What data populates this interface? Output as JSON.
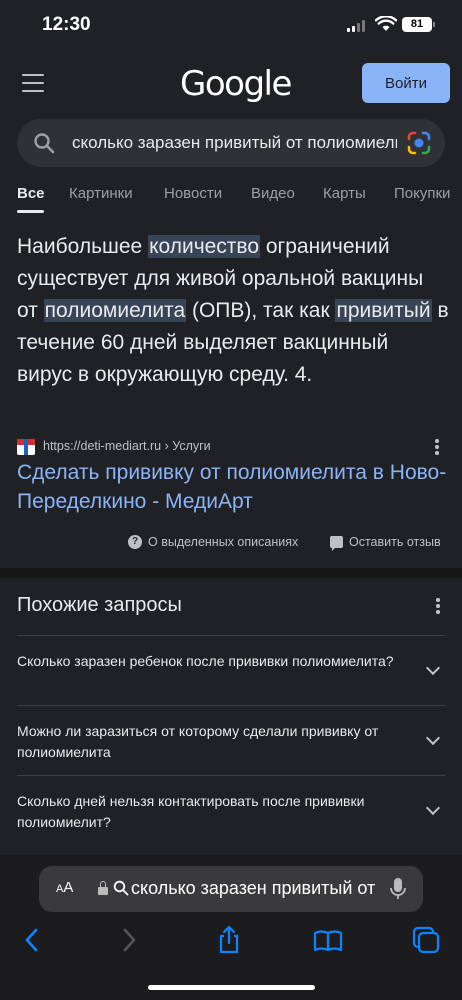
{
  "status_bar": {
    "time": "12:30",
    "battery": "81"
  },
  "header": {
    "logo": "Google",
    "login_label": "Войти"
  },
  "search": {
    "query": "сколько заразен привитый от полиомиелита"
  },
  "tabs": [
    "Все",
    "Картинки",
    "Новости",
    "Видео",
    "Карты",
    "Покупки"
  ],
  "snippet": {
    "parts": [
      {
        "text": "Наибольшее ",
        "hl": false
      },
      {
        "text": "количество",
        "hl": true
      },
      {
        "text": " ограничений существует для живой оральной вакцины от ",
        "hl": false
      },
      {
        "text": "полиомиелита",
        "hl": true
      },
      {
        "text": " (ОПВ), так как ",
        "hl": false
      },
      {
        "text": "привитый",
        "hl": true
      },
      {
        "text": " в течение 60 дней выделяет вакцинный вирус в окружающую среду. 4.",
        "hl": false
      }
    ]
  },
  "result": {
    "source": "https://deti-mediart.ru › Услуги",
    "title": "Сделать прививку от полиомиелита в Ново-Переделкино - МедиАрт"
  },
  "feedback": {
    "about": "О выделенных описаниях",
    "leave": "Оставить отзыв"
  },
  "related": {
    "title": "Похожие запросы",
    "items": [
      "Сколько заразен ребенок после прививки полиомиелита?",
      "Можно ли заразиться от которому сделали прививку от полиомиелита",
      "Сколько дней нельзя контактировать после прививки полиомиелит?"
    ]
  },
  "browser": {
    "aa_small": "A",
    "aa_large": "A",
    "url": "сколько заразен привитый от полиомиелита"
  }
}
